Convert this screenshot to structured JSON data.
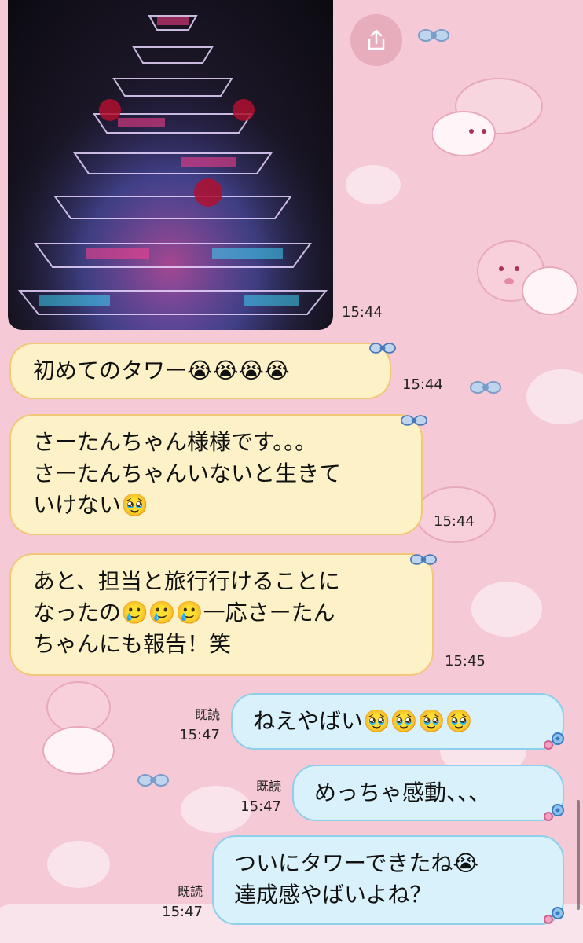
{
  "chat": {
    "photo_time": "15:44",
    "messages": [
      {
        "lines": [
          "初めてのタワー😭😭😭😭"
        ],
        "time": "15:44"
      },
      {
        "lines": [
          "さーたんちゃん様様です。。。",
          "さーたんちゃんいないと生きて",
          "いけない🥹"
        ],
        "time": "15:44"
      },
      {
        "lines": [
          "あと、担当と旅行行けることに",
          "なったの🥲🥲🥲一応さーたん",
          "ちゃんにも報告！笑"
        ],
        "time": "15:45"
      },
      {
        "lines": [
          "ねえやばい🥹🥹🥹🥹"
        ],
        "read": "既読",
        "time": "15:47"
      },
      {
        "lines": [
          "めっちゃ感動、、、"
        ],
        "read": "既読",
        "time": "15:47"
      },
      {
        "lines": [
          "ついにタワーできたね😭",
          "達成感やばいよね？"
        ],
        "read": "既読",
        "time": "15:47"
      }
    ]
  },
  "icons": {
    "share": "share-icon",
    "ribbon": "ribbon-icon",
    "flower": "flower-icon"
  },
  "colors": {
    "background": "#f5c9d6",
    "incoming_bubble": "#fdf1c8",
    "incoming_border": "#f2c878",
    "outgoing_bubble": "#d8f1fb",
    "outgoing_border": "#8ed0ec"
  }
}
